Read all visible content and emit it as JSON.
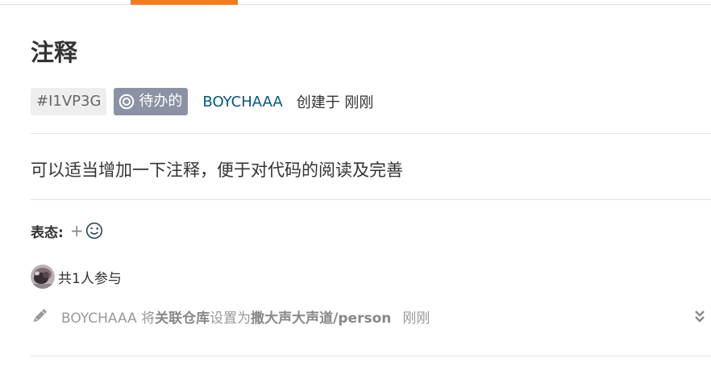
{
  "issue": {
    "title": "注释",
    "id": "#I1VP3G",
    "state": "待办的",
    "author": "BOYCHAAA",
    "created_text": "创建于 刚刚",
    "description": "可以适当增加一下注释，便于对代码的阅读及完善"
  },
  "reactions": {
    "label": "表态:",
    "add_symbol": "+"
  },
  "participants": {
    "text": "共1人参与"
  },
  "activity": {
    "user": "BOYCHAAA",
    "verb1": "将",
    "field": "关联仓库",
    "verb2": "设置为",
    "value": "撒大声大声道/person",
    "time": "刚刚"
  },
  "colors": {
    "accent": "#f37b1d",
    "state_badge": "#8c92a4",
    "author_link": "#005980"
  },
  "icons": {
    "state": "circle-dot-icon",
    "reaction": "smiley-icon",
    "activity": "pencil-icon",
    "expand": "double-chevron-down-icon"
  }
}
